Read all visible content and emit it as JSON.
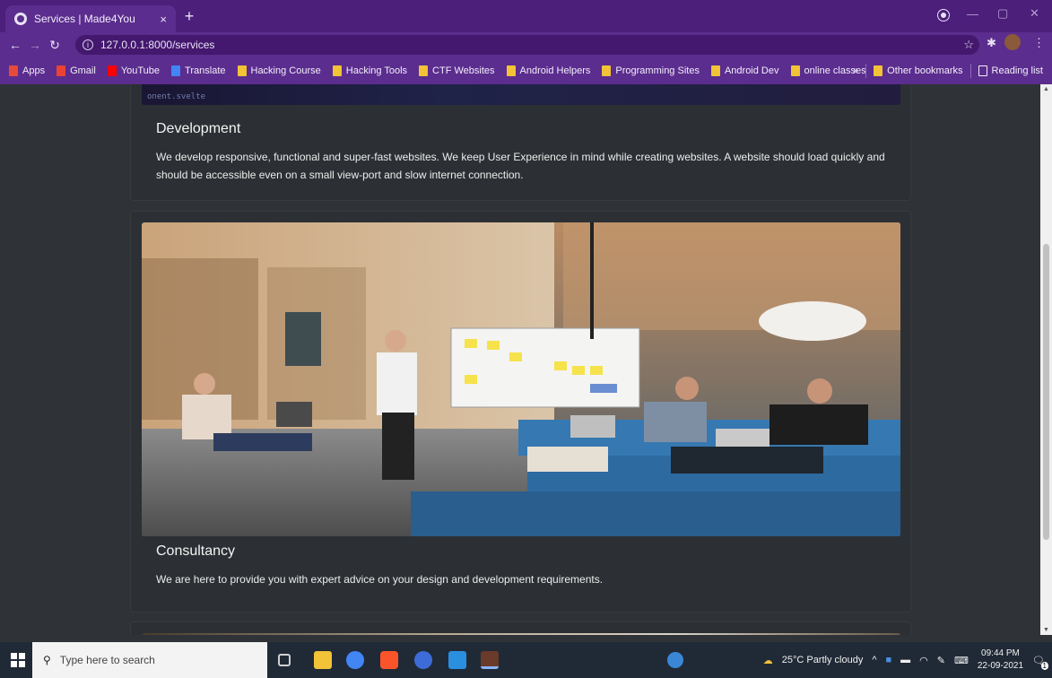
{
  "browser": {
    "tab_title": "Services | Made4You",
    "tab_close": "×",
    "new_tab": "+",
    "url": "127.0.0.1:8000/services",
    "bookmarks": [
      {
        "label": "Apps",
        "icon": "apps-grid-icon",
        "color": "#e64a3b"
      },
      {
        "label": "Gmail",
        "icon": "gmail-icon",
        "color": "#ea4335"
      },
      {
        "label": "YouTube",
        "icon": "youtube-icon",
        "color": "#ff0000"
      },
      {
        "label": "Translate",
        "icon": "translate-icon",
        "color": "#4285f4"
      },
      {
        "label": "Hacking Course",
        "icon": "folder-icon",
        "color": "#f2c237"
      },
      {
        "label": "Hacking Tools",
        "icon": "folder-icon",
        "color": "#f2c237"
      },
      {
        "label": "CTF Websites",
        "icon": "folder-icon",
        "color": "#f2c237"
      },
      {
        "label": "Android Helpers",
        "icon": "folder-icon",
        "color": "#f2c237"
      },
      {
        "label": "Programming Sites",
        "icon": "folder-icon",
        "color": "#f2c237"
      },
      {
        "label": "Android Dev",
        "icon": "folder-icon",
        "color": "#f2c237"
      },
      {
        "label": "online classes",
        "icon": "folder-icon",
        "color": "#f2c237"
      }
    ],
    "overflow": "»",
    "other_bookmarks": "Other bookmarks",
    "reading_list": "Reading list"
  },
  "services": [
    {
      "title": "Development",
      "description": "We develop responsive, functional and super-fast websites. We keep User Experience in mind while creating websites. A website should load quickly and should be accessible even on a small view-port and slow internet connection.",
      "image_caption": "onent.svelte"
    },
    {
      "title": "Consultancy",
      "description": "We are here to provide you with expert advice on your design and development requirements."
    }
  ],
  "taskbar": {
    "search_placeholder": "Type here to search",
    "weather": "25°C  Partly cloudy",
    "time": "09:44 PM",
    "date": "22-09-2021",
    "notification_count": "1"
  }
}
